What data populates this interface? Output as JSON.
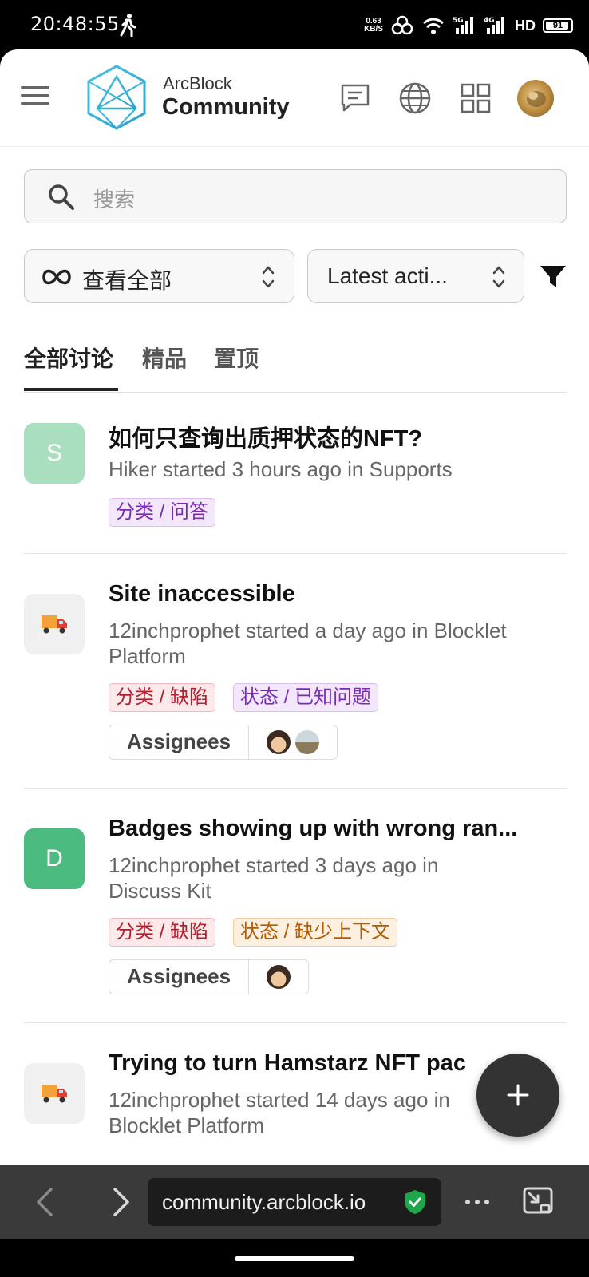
{
  "status_bar": {
    "time": "20:48:55",
    "net_speed_value": "0.63",
    "net_speed_unit": "KB/S",
    "signal_1": "5G",
    "signal_2": "4G",
    "hd": "HD",
    "battery": "91"
  },
  "header": {
    "logo_line1": "ArcBlock",
    "logo_line2": "Community"
  },
  "search": {
    "placeholder": "搜索"
  },
  "filters": {
    "view_select": "查看全部",
    "sort_select": "Latest acti..."
  },
  "tabs": [
    {
      "label": "全部讨论",
      "active": true
    },
    {
      "label": "精品",
      "active": false
    },
    {
      "label": "置顶",
      "active": false
    }
  ],
  "posts": [
    {
      "avatar_letter": "S",
      "title": "如何只查询出质押状态的NFT?",
      "meta": "Hiker started 3 hours ago in Supports",
      "tags": [
        "分类 / 问答"
      ]
    },
    {
      "avatar_letter": "",
      "title": "Site inaccessible",
      "meta": "12inchprophet started a day ago in Blocklet Platform",
      "tags": [
        "分类 / 缺陷",
        "状态 / 已知问题"
      ],
      "assignees_label": "Assignees"
    },
    {
      "avatar_letter": "D",
      "title": "Badges showing up with wrong ran...",
      "meta": "12inchprophet started 3 days ago in Discuss Kit",
      "tags": [
        "分类 / 缺陷",
        "状态 / 缺少上下文"
      ],
      "assignees_label": "Assignees"
    },
    {
      "avatar_letter": "",
      "title": "Trying to turn Hamstarz NFT pac",
      "meta": "12inchprophet started 14 days ago in Blocklet Platform"
    }
  ],
  "browser": {
    "url": "community.arcblock.io"
  },
  "colors": {
    "avatar_s": "#a9dfbf",
    "avatar_d": "#4cbb7f",
    "avatar_truck_bg": "#f0f0f0",
    "logo_accent": "#3ab8d8",
    "secure_shield": "#1fa54a"
  }
}
